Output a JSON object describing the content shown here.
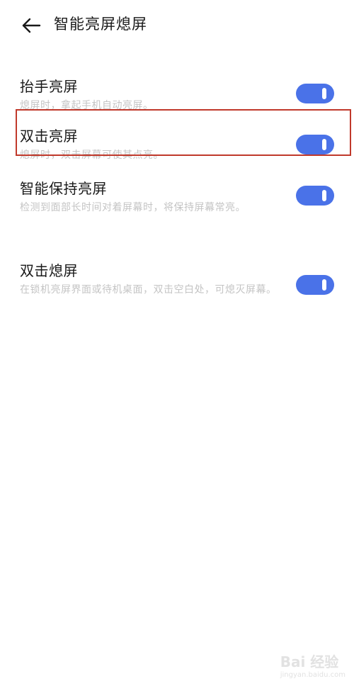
{
  "header": {
    "title": "智能亮屏熄屏",
    "back_icon": "back-arrow-icon"
  },
  "settings": [
    {
      "title": "抬手亮屏",
      "description": "熄屏时，拿起手机自动亮屏。",
      "enabled": true
    },
    {
      "title": "双击亮屏",
      "description": "熄屏时，双击屏幕可使其点亮。",
      "enabled": true
    },
    {
      "title": "智能保持亮屏",
      "description": "检测到面部长时间对着屏幕时，将保持屏幕常亮。",
      "enabled": true
    },
    {
      "title": "双击熄屏",
      "description": "在锁机亮屏界面或待机桌面，双击空白处，可熄灭屏幕。",
      "enabled": true
    }
  ],
  "colors": {
    "toggle_on": "#4a72e8",
    "highlight": "#c0392b",
    "description_text": "#c4c4c4"
  },
  "watermark": {
    "main": "Bai 经验",
    "sub": "jingyan.baidu.com"
  }
}
